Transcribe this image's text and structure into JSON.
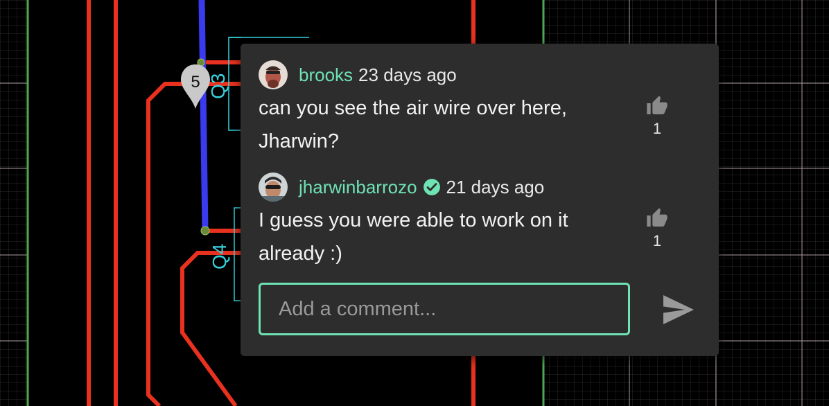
{
  "pcb": {
    "pin_number": "5",
    "component_labels": [
      "Q3",
      "Q4"
    ]
  },
  "comments": [
    {
      "username": "brooks",
      "time": "23 days ago",
      "text": "can you see the air wire over here, Jharwin?",
      "likes": "1",
      "verified": false
    },
    {
      "username": "jharwinbarrozo",
      "time": "21 days ago",
      "text": "I guess you were able to work on it already :)",
      "likes": "1",
      "verified": true
    }
  ],
  "composer": {
    "placeholder": "Add a comment..."
  },
  "colors": {
    "accent": "#6fe3b4",
    "panel_bg": "#2d2d2d",
    "trace_red": "#e8311f",
    "trace_blue": "#3a3aee",
    "silkscreen": "#39d3e0"
  },
  "icons": {
    "like": "thumb-up-icon",
    "send": "send-icon",
    "verified": "verified-check-icon",
    "pin": "location-pin-icon"
  }
}
